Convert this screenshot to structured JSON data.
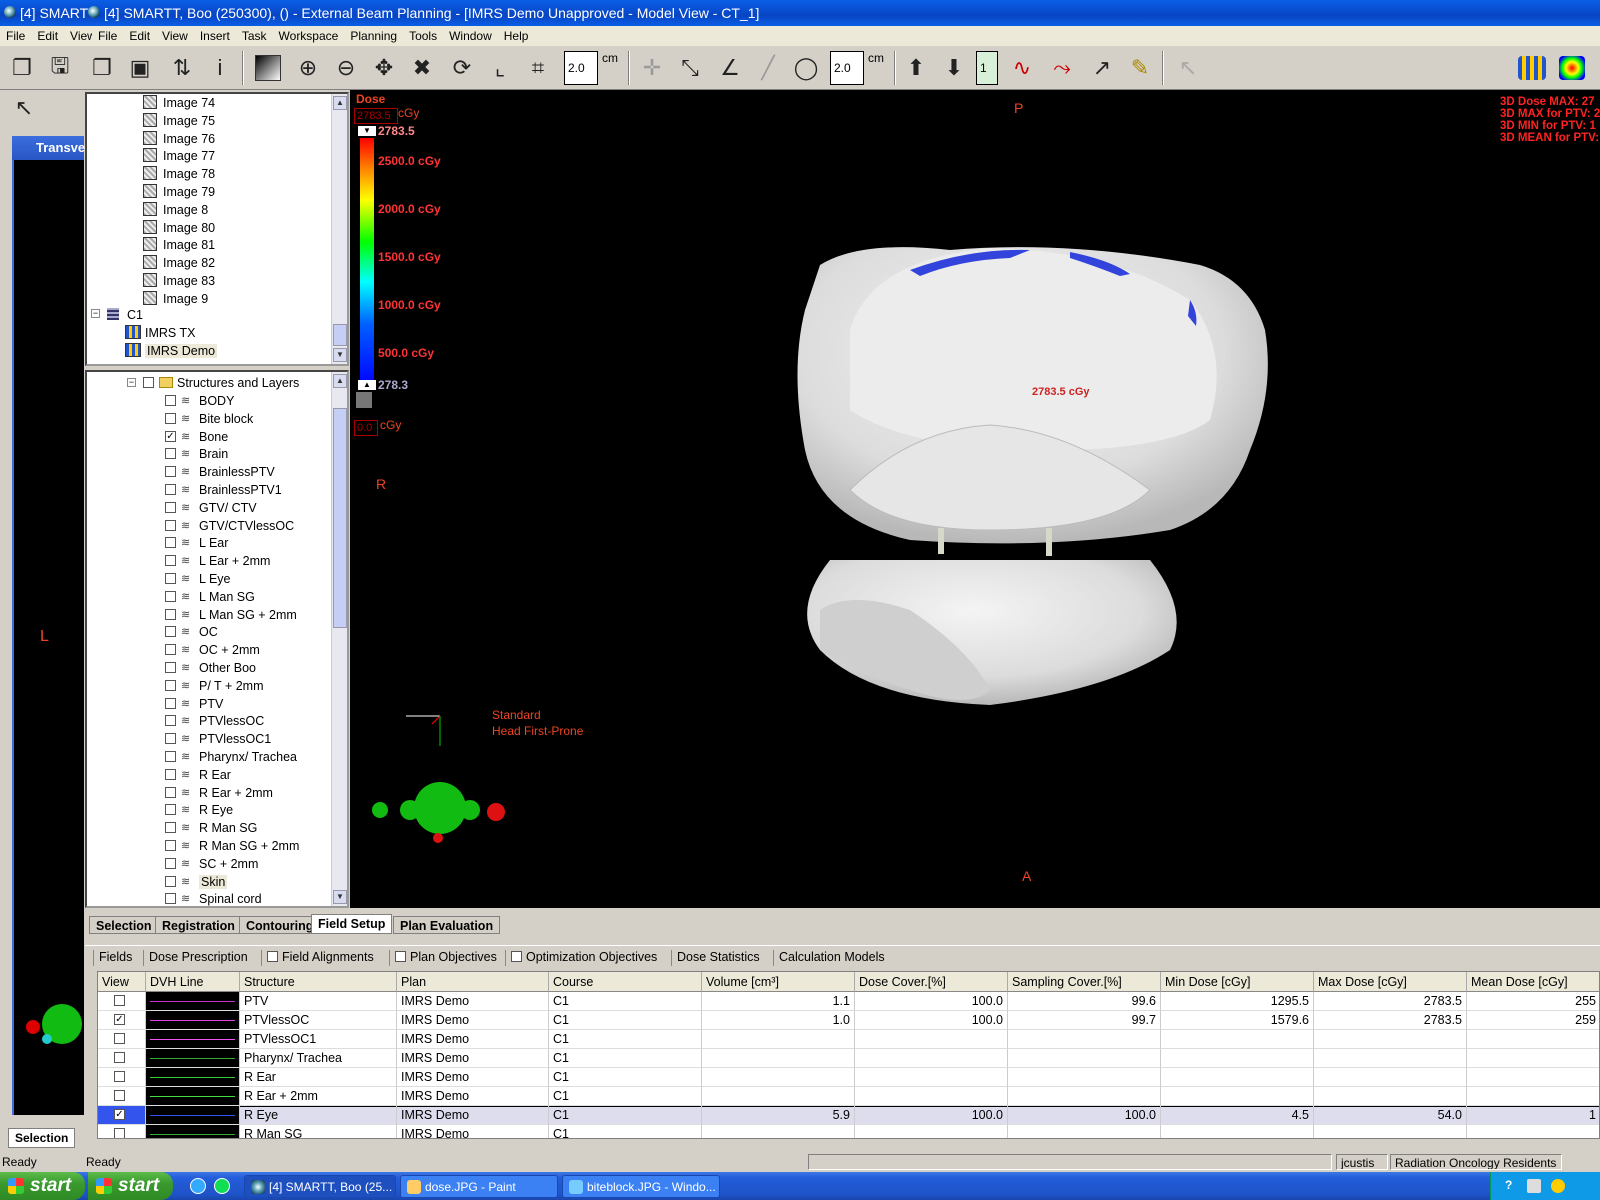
{
  "window": {
    "back_title": "[4] SMARTT",
    "title": "[4] SMARTT, Boo (250300), () - External Beam Planning - [IMRS Demo    Unapproved   -  Model View - CT_1]"
  },
  "outer_menu": [
    "File",
    "Edit",
    "View"
  ],
  "menu": [
    "File",
    "Edit",
    "View",
    "Insert",
    "Task",
    "Workspace",
    "Planning",
    "Tools",
    "Window",
    "Help"
  ],
  "toolbar": {
    "grid_size_1": "2.0",
    "grid_unit_1": "cm",
    "grid_size_2": "2.0",
    "grid_unit_2": "cm",
    "layer_value": "1"
  },
  "left_pane": {
    "title": "Transve",
    "orientation_label": "L"
  },
  "image_tree": {
    "images": [
      "Image 74",
      "Image 75",
      "Image 76",
      "Image 77",
      "Image 78",
      "Image 79",
      "Image 8",
      "Image 80",
      "Image 81",
      "Image 82",
      "Image 83",
      "Image 9"
    ],
    "course": "C1",
    "plans": [
      "IMRS TX",
      "IMRS Demo"
    ]
  },
  "structure_tree": {
    "root": "Structures and Layers",
    "items": [
      {
        "label": "BODY",
        "checked": false
      },
      {
        "label": "Bite block",
        "checked": false
      },
      {
        "label": "Bone",
        "checked": true
      },
      {
        "label": "Brain",
        "checked": false
      },
      {
        "label": "BrainlessPTV",
        "checked": false
      },
      {
        "label": "BrainlessPTV1",
        "checked": false
      },
      {
        "label": "GTV/ CTV",
        "checked": false
      },
      {
        "label": "GTV/CTVlessOC",
        "checked": false
      },
      {
        "label": "L Ear",
        "checked": false
      },
      {
        "label": "L Ear + 2mm",
        "checked": false
      },
      {
        "label": "L Eye",
        "checked": false
      },
      {
        "label": "L Man SG",
        "checked": false
      },
      {
        "label": "L Man SG + 2mm",
        "checked": false
      },
      {
        "label": "OC",
        "checked": false
      },
      {
        "label": "OC + 2mm",
        "checked": false
      },
      {
        "label": "Other Boo",
        "checked": false
      },
      {
        "label": "P/ T + 2mm",
        "checked": false
      },
      {
        "label": "PTV",
        "checked": false
      },
      {
        "label": "PTVlessOC",
        "checked": false
      },
      {
        "label": "PTVlessOC1",
        "checked": false
      },
      {
        "label": "Pharynx/ Trachea",
        "checked": false
      },
      {
        "label": "R Ear",
        "checked": false
      },
      {
        "label": "R Ear + 2mm",
        "checked": false
      },
      {
        "label": "R Eye",
        "checked": false
      },
      {
        "label": "R Man SG",
        "checked": false
      },
      {
        "label": "R Man SG + 2mm",
        "checked": false
      },
      {
        "label": "SC + 2mm",
        "checked": false
      },
      {
        "label": "Skin",
        "checked": false
      },
      {
        "label": "Spinal cord",
        "checked": false
      }
    ]
  },
  "model_view": {
    "dose_title": "Dose",
    "dose_unit": "cGy",
    "dose_max_box": "2783.5",
    "dose_max_label": "2783.5",
    "scale_labels": [
      "2500.0 cGy",
      "2000.0 cGy",
      "1500.0 cGy",
      "1000.0 cGy",
      "500.0 cGy"
    ],
    "dose_min_label": "278.3",
    "dose_zero_box": "0.0",
    "dose_zero_unit": "cGy",
    "orient_top": "P",
    "orient_bottom": "A",
    "orient_left": "R",
    "point_dose": "2783.5 cGy",
    "orientation_line1": "Standard",
    "orientation_line2": "Head First-Prone",
    "stats": [
      "3D Dose MAX: 27",
      "3D MAX for PTV: 2",
      "3D MIN for PTV: 1",
      "3D MEAN for PTV:"
    ],
    "colors": {
      "bone": "#e8e8e8",
      "dose_overlay": "#3344dd",
      "text": "#ee2222"
    }
  },
  "workspace_tabs": [
    {
      "label": "Selection",
      "active": false
    },
    {
      "label": "Registration",
      "active": false
    },
    {
      "label": "Contouring",
      "active": false
    },
    {
      "label": "Field Setup",
      "active": true
    },
    {
      "label": "Plan Evaluation",
      "active": false
    }
  ],
  "sub_tabs": [
    {
      "label": "Fields",
      "checkbox": false
    },
    {
      "label": "Dose Prescription",
      "checkbox": false
    },
    {
      "label": "Field Alignments",
      "checkbox": true
    },
    {
      "label": "Plan Objectives",
      "checkbox": true
    },
    {
      "label": "Optimization Objectives",
      "checkbox": true
    },
    {
      "label": "Dose Statistics",
      "checkbox": false
    },
    {
      "label": "Calculation Models",
      "checkbox": false
    }
  ],
  "grid": {
    "columns": [
      "View",
      "DVH Line",
      "Structure",
      "Plan",
      "Course",
      "Volume [cm³]",
      "Dose Cover.[%]",
      "Sampling Cover.[%]",
      "Min Dose [cGy]",
      "Max Dose [cGy]",
      "Mean Dose [cGy]"
    ],
    "rows": [
      {
        "view": false,
        "dvh_color": "#cc33cc",
        "structure": "PTV",
        "plan": "IMRS Demo",
        "course": "C1",
        "volume": "1.1",
        "dose_cover": "100.0",
        "sampling_cover": "99.6",
        "min_dose": "1295.5",
        "max_dose": "2783.5",
        "mean_dose": "255",
        "selected": false
      },
      {
        "view": true,
        "dvh_color": "#dd44dd",
        "structure": "PTVlessOC",
        "plan": "IMRS Demo",
        "course": "C1",
        "volume": "1.0",
        "dose_cover": "100.0",
        "sampling_cover": "99.7",
        "min_dose": "1579.6",
        "max_dose": "2783.5",
        "mean_dose": "259",
        "selected": false
      },
      {
        "view": false,
        "dvh_color": "#ee55ee",
        "structure": "PTVlessOC1",
        "plan": "IMRS Demo",
        "course": "C1",
        "volume": "",
        "dose_cover": "",
        "sampling_cover": "",
        "min_dose": "",
        "max_dose": "",
        "mean_dose": "",
        "selected": false
      },
      {
        "view": false,
        "dvh_color": "#33aa33",
        "structure": "Pharynx/ Trachea",
        "plan": "IMRS Demo",
        "course": "C1",
        "volume": "",
        "dose_cover": "",
        "sampling_cover": "",
        "min_dose": "",
        "max_dose": "",
        "mean_dose": "",
        "selected": false
      },
      {
        "view": false,
        "dvh_color": "#33cc33",
        "structure": "R Ear",
        "plan": "IMRS Demo",
        "course": "C1",
        "volume": "",
        "dose_cover": "",
        "sampling_cover": "",
        "min_dose": "",
        "max_dose": "",
        "mean_dose": "",
        "selected": false
      },
      {
        "view": false,
        "dvh_color": "#44dd44",
        "structure": "R Ear + 2mm",
        "plan": "IMRS Demo",
        "course": "C1",
        "volume": "",
        "dose_cover": "",
        "sampling_cover": "",
        "min_dose": "",
        "max_dose": "",
        "mean_dose": "",
        "selected": false
      },
      {
        "view": true,
        "dvh_color": "#3355ee",
        "structure": "R Eye",
        "plan": "IMRS Demo",
        "course": "C1",
        "volume": "5.9",
        "dose_cover": "100.0",
        "sampling_cover": "100.0",
        "min_dose": "4.5",
        "max_dose": "54.0",
        "mean_dose": "1",
        "selected": true
      },
      {
        "view": false,
        "dvh_color": "#33aa33",
        "structure": "R Man SG",
        "plan": "IMRS Demo",
        "course": "C1",
        "volume": "",
        "dose_cover": "",
        "sampling_cover": "",
        "min_dose": "",
        "max_dose": "",
        "mean_dose": "",
        "selected": false
      }
    ]
  },
  "left_bottom_tab": "Selection",
  "status": {
    "left": "Ready",
    "second": "Ready",
    "user": "jcustis",
    "department": "Radiation Oncology Residents"
  },
  "taskbar": {
    "start_label": "start",
    "items": [
      "[4] SMARTT, Boo (25...",
      "dose.JPG - Paint",
      "biteblock.JPG - Windo..."
    ]
  }
}
